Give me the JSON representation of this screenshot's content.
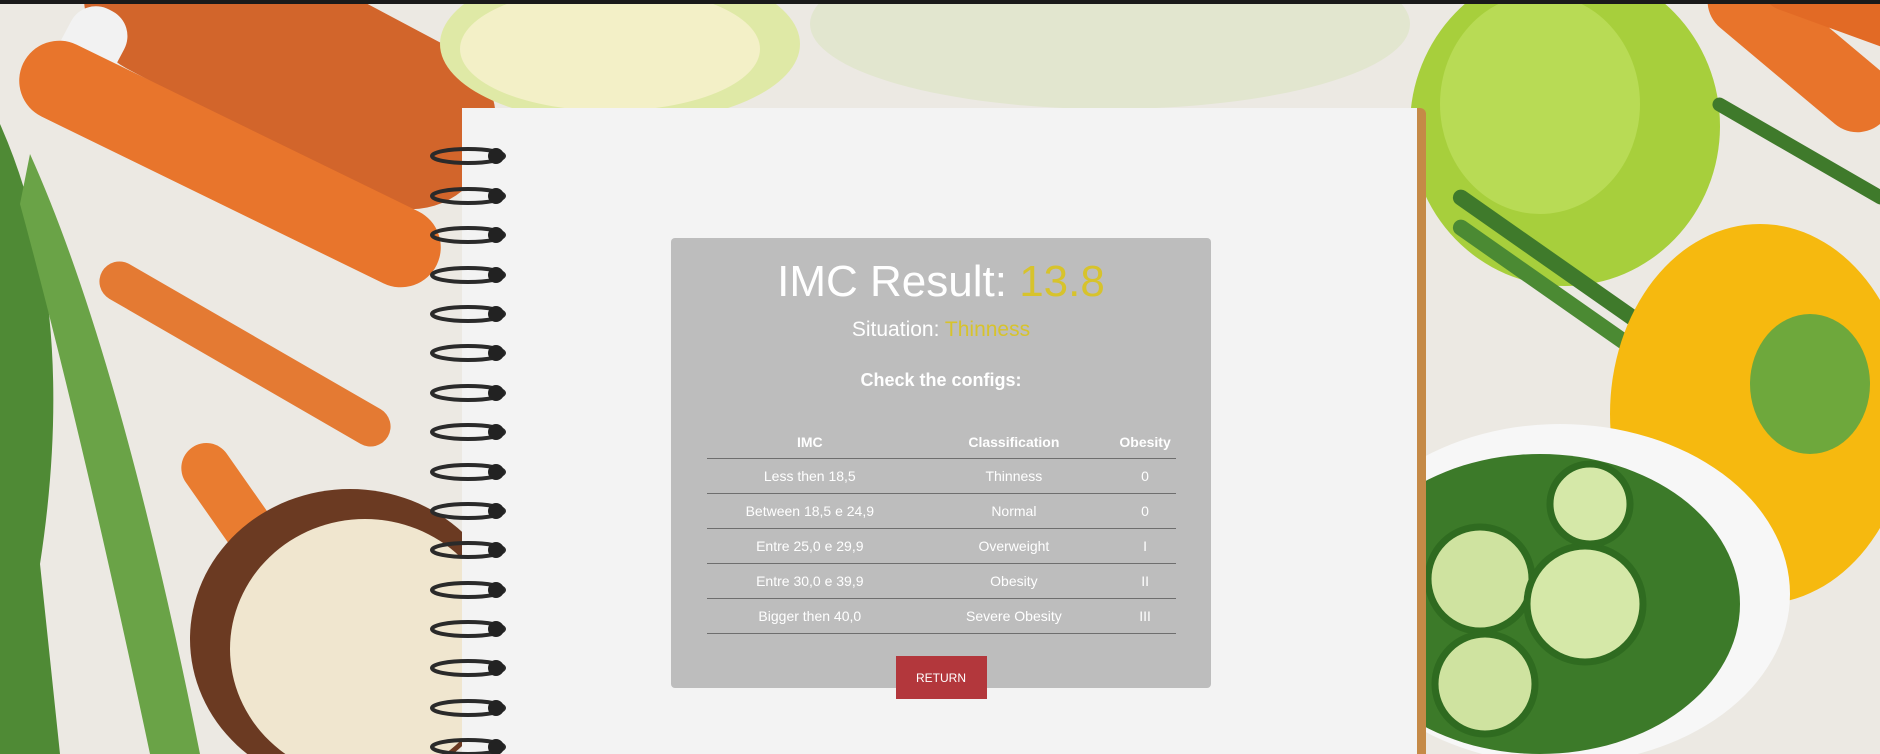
{
  "result": {
    "title_label": "IMC Result:",
    "value": "13.8",
    "situation_label": "Situation:",
    "situation_value": "Thinness"
  },
  "configs": {
    "heading": "Check the configs:",
    "headers": [
      "IMC",
      "Classification",
      "Obesity"
    ],
    "rows": [
      [
        "Less then 18,5",
        "Thinness",
        "0"
      ],
      [
        "Between 18,5 e 24,9",
        "Normal",
        "0"
      ],
      [
        "Entre 25,0 e 29,9",
        "Overweight",
        "I"
      ],
      [
        "Entre 30,0 e 39,9",
        "Obesity",
        "II"
      ],
      [
        "Bigger then 40,0",
        "Severe Obesity",
        "III"
      ]
    ]
  },
  "actions": {
    "return_label": "RETURN"
  },
  "colors": {
    "accent_value": "#d7c32c",
    "button": "#b3373c",
    "card": "#bdbdbd"
  }
}
